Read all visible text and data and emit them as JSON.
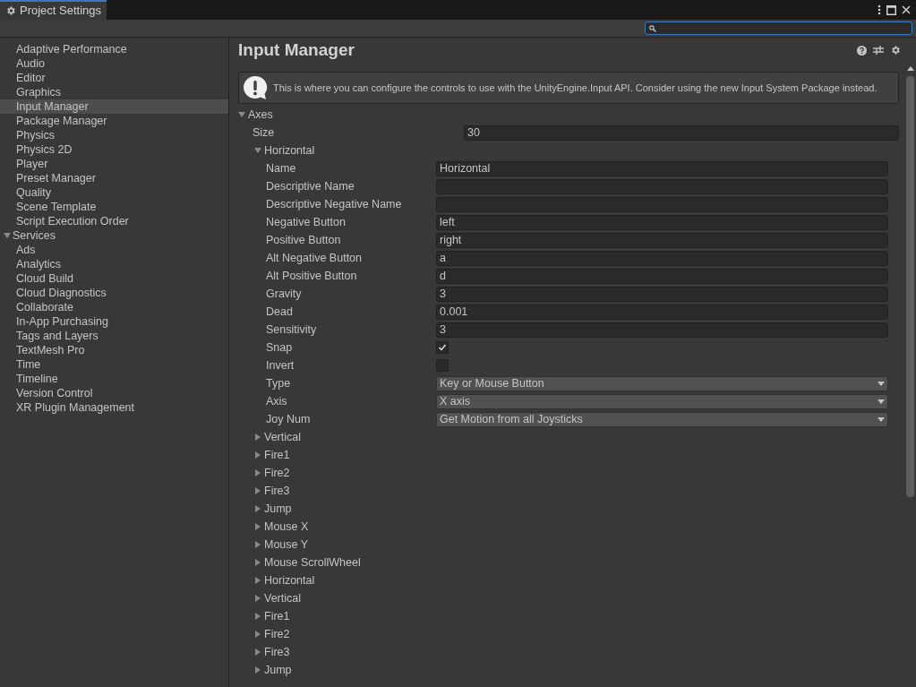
{
  "window": {
    "title": "Project Settings"
  },
  "sidebar": {
    "items": [
      {
        "label": "Adaptive Performance",
        "selected": false
      },
      {
        "label": "Audio",
        "selected": false
      },
      {
        "label": "Editor",
        "selected": false
      },
      {
        "label": "Graphics",
        "selected": false
      },
      {
        "label": "Input Manager",
        "selected": true
      },
      {
        "label": "Package Manager",
        "selected": false
      },
      {
        "label": "Physics",
        "selected": false
      },
      {
        "label": "Physics 2D",
        "selected": false
      },
      {
        "label": "Player",
        "selected": false
      },
      {
        "label": "Preset Manager",
        "selected": false
      },
      {
        "label": "Quality",
        "selected": false
      },
      {
        "label": "Scene Template",
        "selected": false
      },
      {
        "label": "Script Execution Order",
        "selected": false
      },
      {
        "label": "Services",
        "selected": false,
        "expanded": true,
        "children": [
          {
            "label": "Ads",
            "selected": false
          },
          {
            "label": "Analytics",
            "selected": false
          },
          {
            "label": "Cloud Build",
            "selected": false
          },
          {
            "label": "Cloud Diagnostics",
            "selected": false
          },
          {
            "label": "Collaborate",
            "selected": false
          },
          {
            "label": "In-App Purchasing",
            "selected": false
          }
        ]
      },
      {
        "label": "Tags and Layers",
        "selected": false
      },
      {
        "label": "TextMesh Pro",
        "selected": false
      },
      {
        "label": "Time",
        "selected": false
      },
      {
        "label": "Timeline",
        "selected": false
      },
      {
        "label": "Version Control",
        "selected": false
      },
      {
        "label": "XR Plugin Management",
        "selected": false
      }
    ]
  },
  "main": {
    "title": "Input Manager",
    "notice": "This is where you can configure the controls to use with the UnityEngine.Input API. Consider using the new Input System Package instead.",
    "axes": {
      "label": "Axes",
      "expanded": true,
      "size": {
        "label": "Size",
        "value": "30"
      },
      "items": [
        {
          "label": "Horizontal",
          "expanded": true,
          "fields": [
            {
              "kind": "text",
              "label": "Name",
              "value": "Horizontal"
            },
            {
              "kind": "text",
              "label": "Descriptive Name"
            },
            {
              "kind": "text",
              "label": "Descriptive Negative Name"
            },
            {
              "kind": "text",
              "label": "Negative Button",
              "value": "left"
            },
            {
              "kind": "text",
              "label": "Positive Button",
              "value": "right"
            },
            {
              "kind": "text",
              "label": "Alt Negative Button",
              "value": "a"
            },
            {
              "kind": "text",
              "label": "Alt Positive Button",
              "value": "d"
            },
            {
              "kind": "text",
              "label": "Gravity",
              "value": "3"
            },
            {
              "kind": "text",
              "label": "Dead",
              "value": "0.001"
            },
            {
              "kind": "text",
              "label": "Sensitivity",
              "value": "3"
            },
            {
              "kind": "checkbox",
              "label": "Snap",
              "checked": true
            },
            {
              "kind": "checkbox",
              "label": "Invert",
              "checked": false
            },
            {
              "kind": "dropdown",
              "label": "Type",
              "value": "Key or Mouse Button"
            },
            {
              "kind": "dropdown",
              "label": "Axis",
              "value": "X axis"
            },
            {
              "kind": "dropdown",
              "label": "Joy Num",
              "value": "Get Motion from all Joysticks"
            }
          ]
        },
        {
          "label": "Vertical",
          "expanded": false
        },
        {
          "label": "Fire1",
          "expanded": false
        },
        {
          "label": "Fire2",
          "expanded": false
        },
        {
          "label": "Fire3",
          "expanded": false
        },
        {
          "label": "Jump",
          "expanded": false
        },
        {
          "label": "Mouse X",
          "expanded": false
        },
        {
          "label": "Mouse Y",
          "expanded": false
        },
        {
          "label": "Mouse ScrollWheel",
          "expanded": false
        },
        {
          "label": "Horizontal",
          "expanded": false
        },
        {
          "label": "Vertical",
          "expanded": false
        },
        {
          "label": "Fire1",
          "expanded": false
        },
        {
          "label": "Fire2",
          "expanded": false
        },
        {
          "label": "Fire3",
          "expanded": false
        },
        {
          "label": "Jump",
          "expanded": false
        }
      ]
    }
  }
}
